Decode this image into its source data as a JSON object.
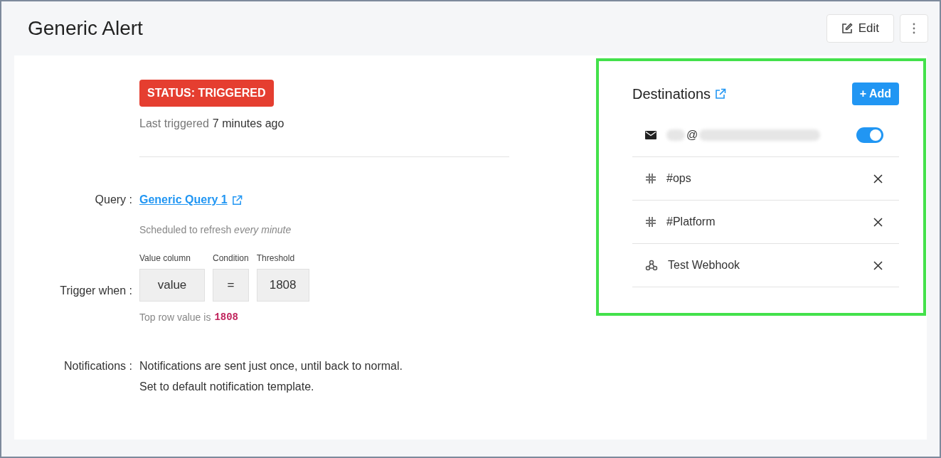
{
  "header": {
    "title": "Generic Alert",
    "edit_button": "Edit"
  },
  "status": {
    "label": "STATUS: TRIGGERED"
  },
  "last_triggered": {
    "label": "Last triggered",
    "value": "7 minutes ago"
  },
  "query": {
    "label": "Query :",
    "link": "Generic Query 1",
    "schedule_prefix": "Scheduled to refresh",
    "schedule_value": "every minute"
  },
  "trigger": {
    "label": "Trigger when :",
    "fields": [
      {
        "caption": "Value column",
        "value": "value"
      },
      {
        "caption": "Condition",
        "value": "="
      },
      {
        "caption": "Threshold",
        "value": "1808"
      }
    ],
    "top_row_prefix": "Top row value is",
    "top_row_value": "1808"
  },
  "notifications": {
    "label": "Notifications :",
    "lines": [
      "Notifications are sent just once, until back to normal.",
      "Set to default notification template."
    ]
  },
  "destinations": {
    "title": "Destinations",
    "add_button": "+ Add",
    "items": [
      {
        "kind": "email",
        "name": "@",
        "on": true
      },
      {
        "kind": "slack",
        "name": "#ops"
      },
      {
        "kind": "slack",
        "name": "#Platform"
      },
      {
        "kind": "webhook",
        "name": "Test Webhook"
      }
    ]
  }
}
